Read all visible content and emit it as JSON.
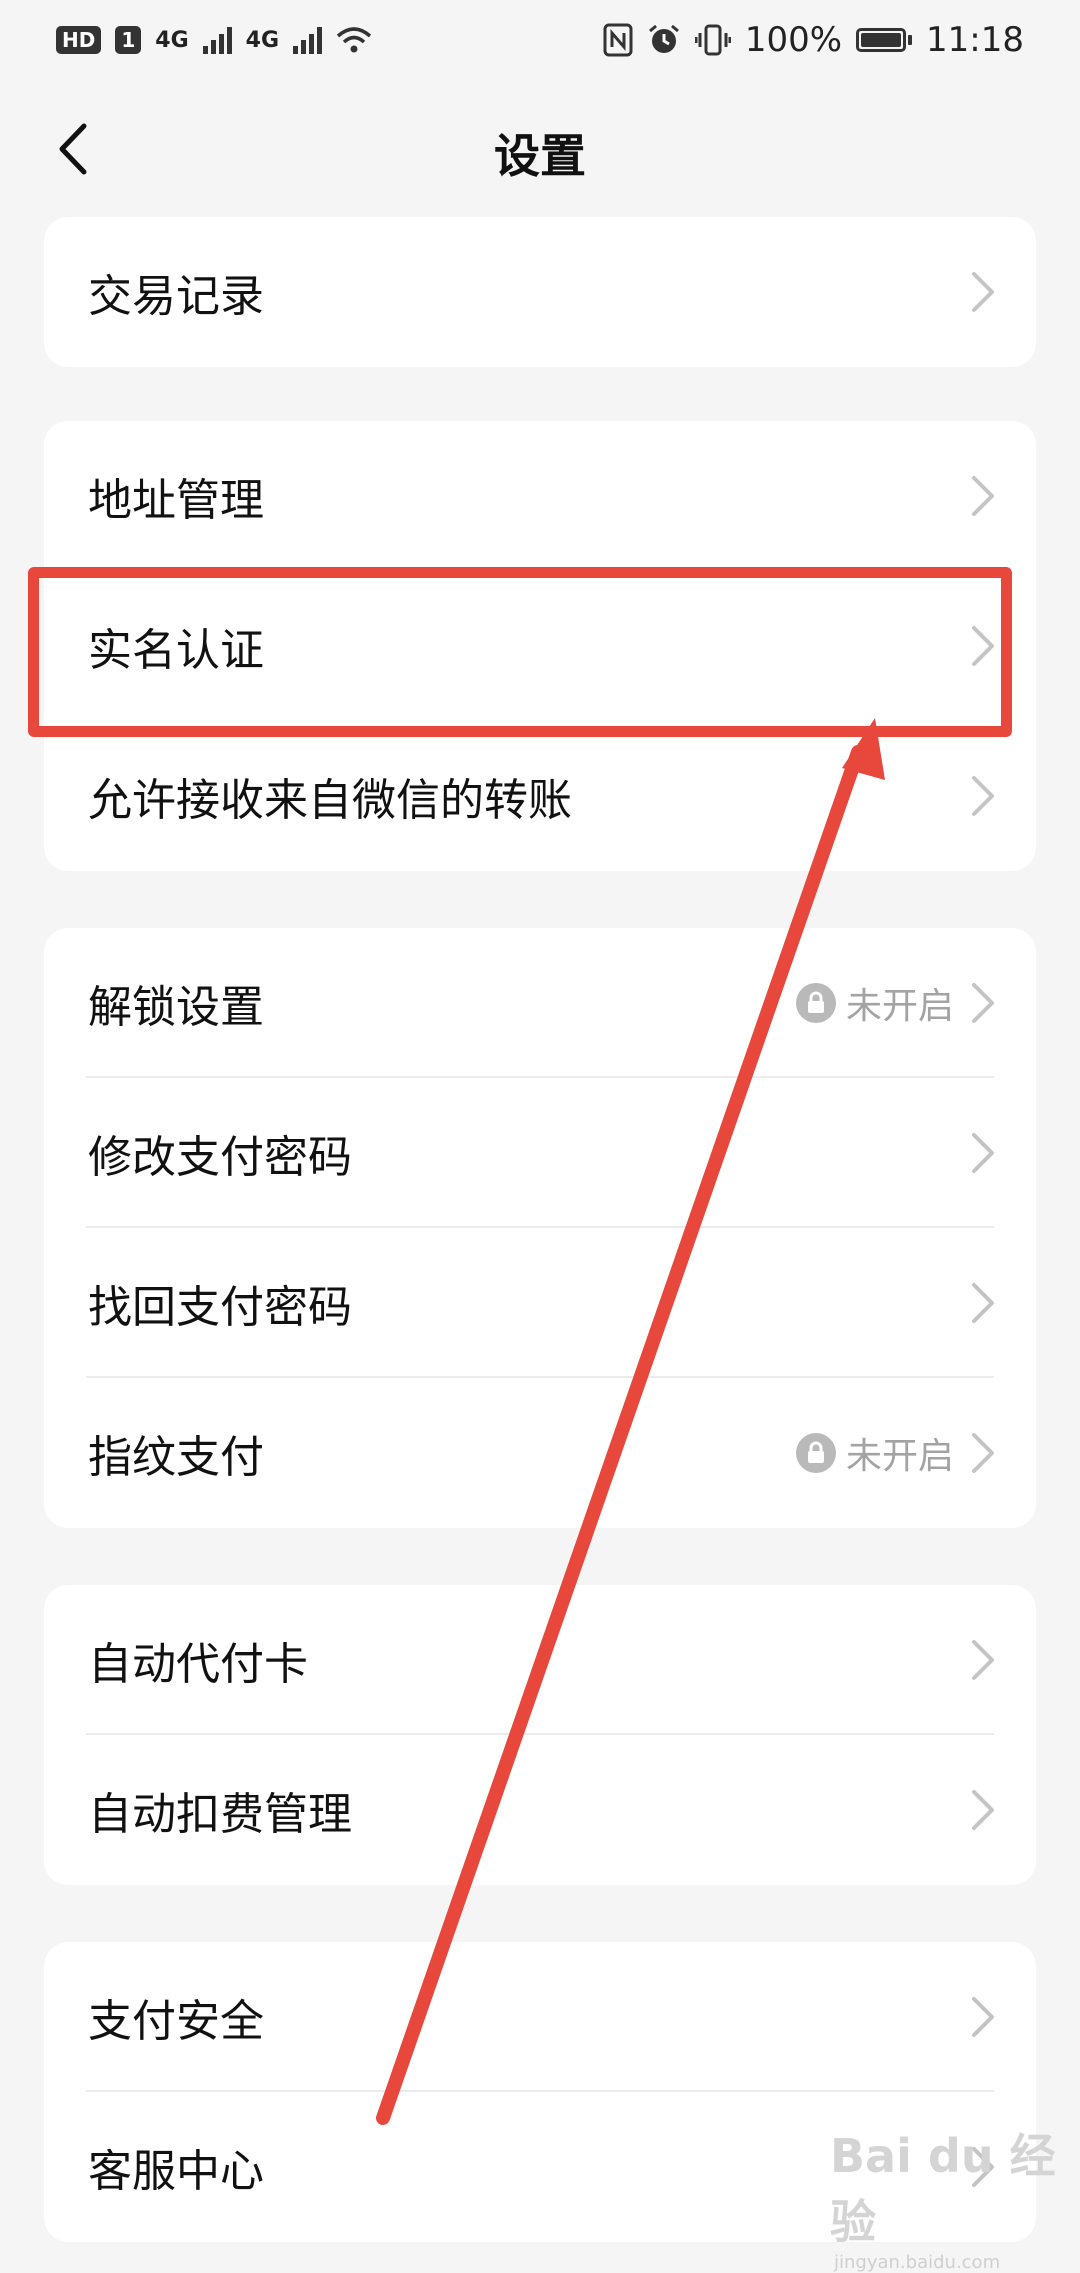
{
  "status_bar": {
    "hd_badge": "HD",
    "sim_badge": "1",
    "network_1": "4G",
    "network_2": "4G",
    "battery_text": "100%",
    "time": "11:18",
    "icons": [
      "nfc-icon",
      "alarm-icon",
      "vibrate-icon",
      "wifi-icon",
      "battery-icon"
    ]
  },
  "header": {
    "title": "设置",
    "back_icon": "chevron-left-icon"
  },
  "groups": [
    {
      "items": [
        {
          "label": "交易记录"
        }
      ]
    },
    {
      "items": [
        {
          "label": "地址管理"
        },
        {
          "label": "实名认证"
        },
        {
          "label": "允许接收来自微信的转账"
        }
      ]
    },
    {
      "items": [
        {
          "label": "解锁设置",
          "status": "未开启"
        },
        {
          "label": "修改支付密码"
        },
        {
          "label": "找回支付密码"
        },
        {
          "label": "指纹支付",
          "status": "未开启"
        }
      ]
    },
    {
      "items": [
        {
          "label": "自动代付卡"
        },
        {
          "label": "自动扣费管理"
        }
      ]
    },
    {
      "items": [
        {
          "label": "支付安全"
        },
        {
          "label": "客服中心"
        }
      ]
    }
  ],
  "watermark": {
    "brand": "Bai du 经验",
    "url": "jingyan.baidu.com"
  },
  "colors": {
    "background": "#f5f5f5",
    "card": "#ffffff",
    "annotation_red": "#e8483c",
    "muted_text": "#a3a3a3"
  }
}
